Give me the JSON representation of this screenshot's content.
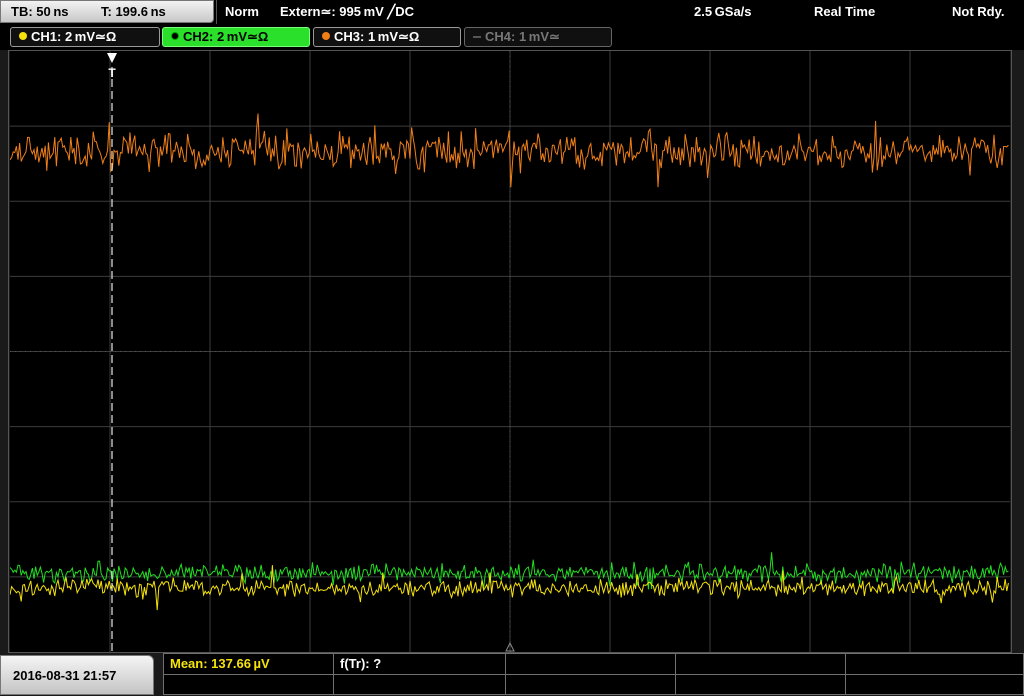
{
  "topbar": {
    "timebase": "TB: 50 ns",
    "trigger_time": "T: 199.6 ns",
    "mode": "Norm",
    "trigger_source": "Extern≃: 995 mV ╱DC",
    "sample_rate": "2.5 GSa/s",
    "acq_mode": "Real Time",
    "status": "Not Rdy."
  },
  "channels": [
    {
      "label": "CH1: 2 mV≃Ω",
      "color": "#f5e20b",
      "active": true
    },
    {
      "label": "CH2: 2 mV≃Ω",
      "color": "#22dd22",
      "active": true,
      "selected": true
    },
    {
      "label": "CH3: 1 mV≃Ω",
      "color": "#f07f18",
      "active": true
    },
    {
      "label": "CH4: 1 mV≃",
      "color": "#666666",
      "active": false
    }
  ],
  "plot": {
    "trigger_marker": "T",
    "grid_color": "#3c3c3c",
    "traces": [
      {
        "name": "CH3",
        "color": "#f07f18"
      },
      {
        "name": "CH2",
        "color": "#22dd22"
      },
      {
        "name": "CH1",
        "color": "#f5e20b"
      }
    ]
  },
  "bottombar": {
    "datetime": "2016-08-31 21:57",
    "mean_measurement": "Mean: 137.66 µV",
    "freq_measurement": "f(Tr): ?"
  }
}
